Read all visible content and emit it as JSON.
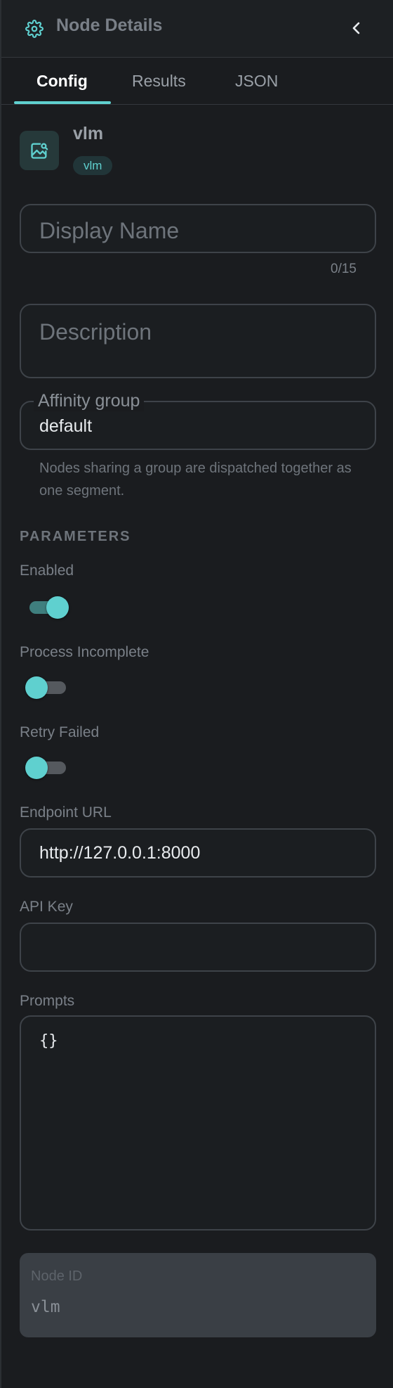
{
  "header": {
    "title": "Node Details"
  },
  "tabs": [
    {
      "label": "Config"
    },
    {
      "label": "Results"
    },
    {
      "label": "JSON"
    }
  ],
  "active_tab": "Config",
  "node": {
    "name": "vlm",
    "type_badge": "vlm"
  },
  "display_name": {
    "placeholder": "Display Name",
    "value": "",
    "counter": "0/15"
  },
  "description": {
    "placeholder": "Description",
    "value": ""
  },
  "affinity": {
    "label": "Affinity group",
    "value": "default",
    "helper": "Nodes sharing a group are dispatched together as one segment."
  },
  "parameters": {
    "section_title": "PARAMETERS",
    "enabled": {
      "label": "Enabled",
      "on": true
    },
    "process_incomplete": {
      "label": "Process Incomplete",
      "on": false
    },
    "retry_failed": {
      "label": "Retry Failed",
      "on": false
    },
    "endpoint_url": {
      "label": "Endpoint URL",
      "value": "http://127.0.0.1:8000"
    },
    "api_key": {
      "label": "API Key",
      "value": ""
    },
    "prompts": {
      "label": "Prompts",
      "value": "{}"
    }
  },
  "node_id": {
    "label": "Node ID",
    "value": "vlm"
  },
  "colors": {
    "accent": "#5fd0cf",
    "panel_bg": "#1a1c1f",
    "border": "#3e4349"
  },
  "icons": {
    "header": "gear-icon",
    "collapse": "chevron-left-icon",
    "node": "image-search-icon"
  }
}
